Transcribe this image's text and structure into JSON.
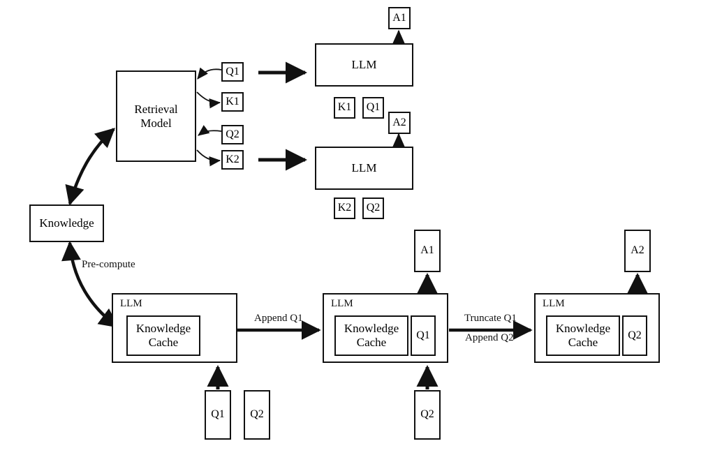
{
  "diagram": {
    "title": "Knowledge cache LLM pipeline diagram",
    "stroke_color": "#111111",
    "background_color": "#ffffff"
  },
  "top_flow": {
    "knowledge_box": {
      "label": "Knowledge"
    },
    "retrieval_model": {
      "label": "Retrieval\nModel",
      "line1": "Retrieval",
      "line2": "Model"
    },
    "retrieval_outputs": [
      {
        "label": "Q1",
        "name": "retrieval-q1"
      },
      {
        "label": "K1",
        "name": "retrieval-k1"
      },
      {
        "label": "Q2",
        "name": "retrieval-q2"
      },
      {
        "label": "K2",
        "name": "retrieval-k2"
      }
    ],
    "llm_1": {
      "label": "LLM",
      "answer": "A1",
      "inputs": [
        "K1",
        "Q1"
      ]
    },
    "llm_2": {
      "label": "LLM",
      "answer": "A2",
      "inputs": [
        "K2",
        "Q2"
      ]
    }
  },
  "bottom_flow": {
    "precompute_label": "Pre-compute",
    "stage_1": {
      "llm_label": "LLM",
      "cache_label": "Knowledge\nCache",
      "cache_line1": "Knowledge",
      "cache_line2": "Cache",
      "query_slot": "",
      "answer": ""
    },
    "stage_2": {
      "llm_label": "LLM",
      "cache_label": "Knowledge\nCache",
      "cache_line1": "Knowledge",
      "cache_line2": "Cache",
      "query_slot": "Q1",
      "answer": "A1"
    },
    "stage_3": {
      "llm_label": "LLM",
      "cache_label": "Knowledge\nCache",
      "cache_line1": "Knowledge",
      "cache_line2": "Cache",
      "query_slot": "Q2",
      "answer": "A2"
    },
    "transitions": [
      {
        "name": "append-q1",
        "lines": [
          "Append Q1"
        ]
      },
      {
        "name": "truncate-append",
        "lines": [
          "Truncate Q1",
          "Append Q2"
        ]
      }
    ],
    "transition_1_line1": "Append Q1",
    "transition_2_line1": "Truncate Q1",
    "transition_2_line2": "Append Q2",
    "pending_queries": [
      {
        "label": "Q1",
        "name": "pending-query-q1"
      },
      {
        "label": "Q2",
        "name": "pending-query-q2"
      }
    ],
    "stage2_query": "Q2"
  }
}
